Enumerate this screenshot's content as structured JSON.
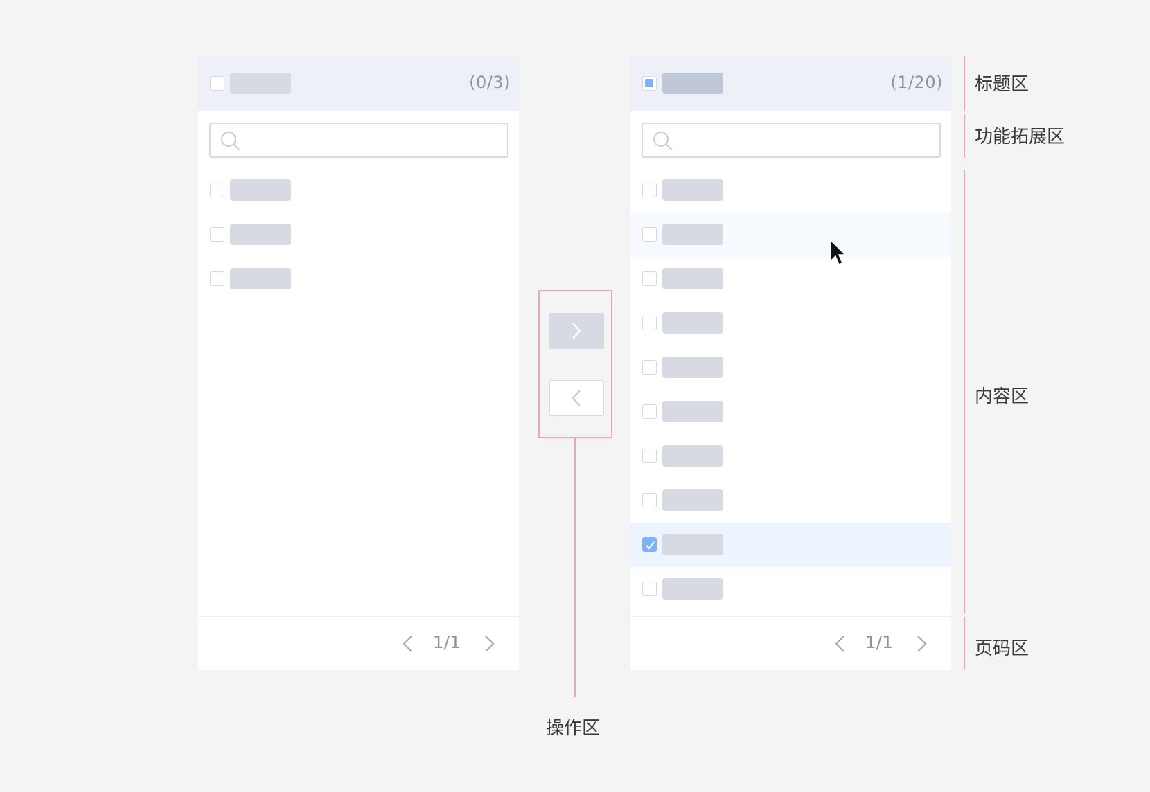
{
  "left_panel": {
    "count": "(0/3)",
    "pager": {
      "page": "1/1"
    }
  },
  "right_panel": {
    "count": "(1/20)",
    "pager": {
      "page": "1/1"
    }
  },
  "annotations": {
    "title_area": "标题区",
    "feature_area": "功能拓展区",
    "content_area": "内容区",
    "pager_area": "页码区",
    "operation_area": "操作区"
  },
  "colors": {
    "accent": "#7eb2f8",
    "annotation": "#f1a4ad",
    "placeholder": "#d7dae3",
    "header_bg": "#edf0f7",
    "background": "#f4f4f4"
  },
  "icons": {
    "search": "search-icon",
    "prev": "chevron-left-icon",
    "next": "chevron-right-icon",
    "check": "check-icon",
    "cursor": "mouse-cursor-icon"
  }
}
